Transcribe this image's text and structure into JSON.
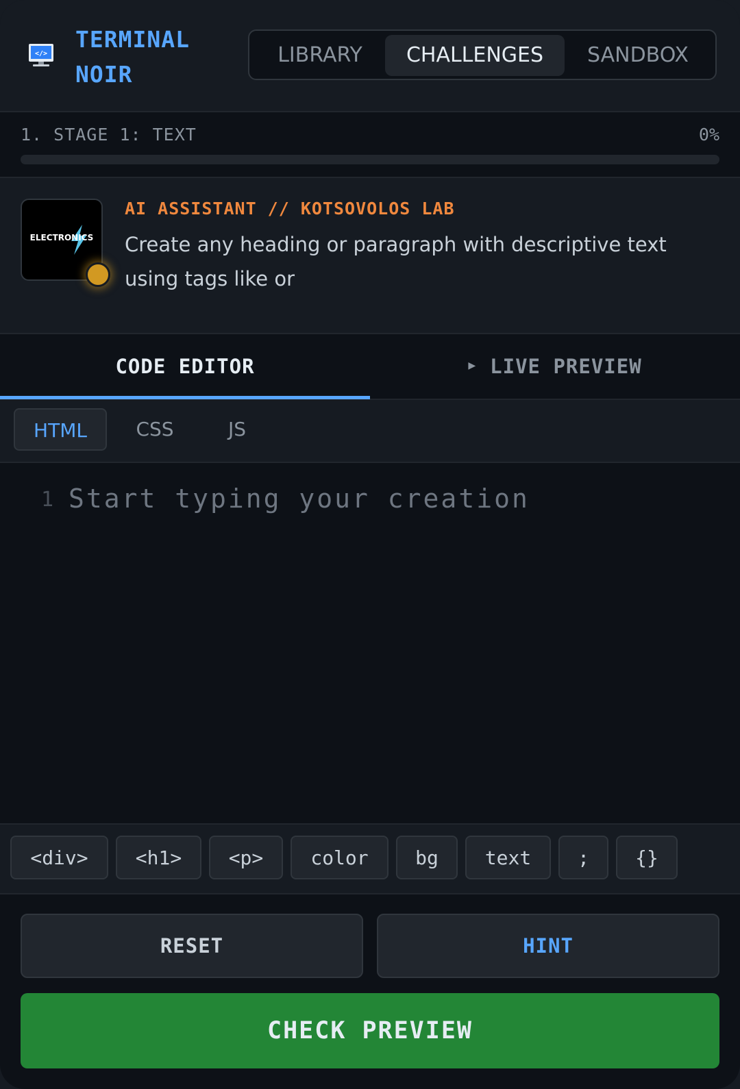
{
  "brand": {
    "line1": "TERMINAL",
    "line2": "NOIR",
    "icon": "monitor-code-icon"
  },
  "nav": {
    "tabs": [
      {
        "label": "LIBRARY",
        "active": false
      },
      {
        "label": "CHALLENGES",
        "active": true
      },
      {
        "label": "SANDBOX",
        "active": false
      }
    ]
  },
  "stage": {
    "title": "1. STAGE 1: TEXT",
    "percent_label": "0%",
    "progress": 0
  },
  "assistant": {
    "avatar_text": "ELECTRONICS",
    "title": "AI ASSISTANT // KOTSOVOLOS LAB",
    "message": "Create any heading or paragraph with descriptive text using tags like or"
  },
  "view_tabs": {
    "code": "CODE EDITOR",
    "preview": "LIVE PREVIEW"
  },
  "lang_tabs": [
    {
      "label": "HTML",
      "active": true
    },
    {
      "label": "CSS",
      "active": false
    },
    {
      "label": "JS",
      "active": false
    }
  ],
  "editor": {
    "line_number": "1",
    "value": "",
    "placeholder": "Start typing your creation"
  },
  "snippets": [
    "<div>",
    "<h1>",
    "<p>",
    "color",
    "bg",
    "text",
    ";",
    "{}"
  ],
  "actions": {
    "reset": "RESET",
    "hint": "HINT",
    "check": "CHECK PREVIEW"
  },
  "colors": {
    "accent": "#58a6ff",
    "assistant_title": "#f0883e",
    "status_dot": "#d29922",
    "check_button": "#238636"
  }
}
